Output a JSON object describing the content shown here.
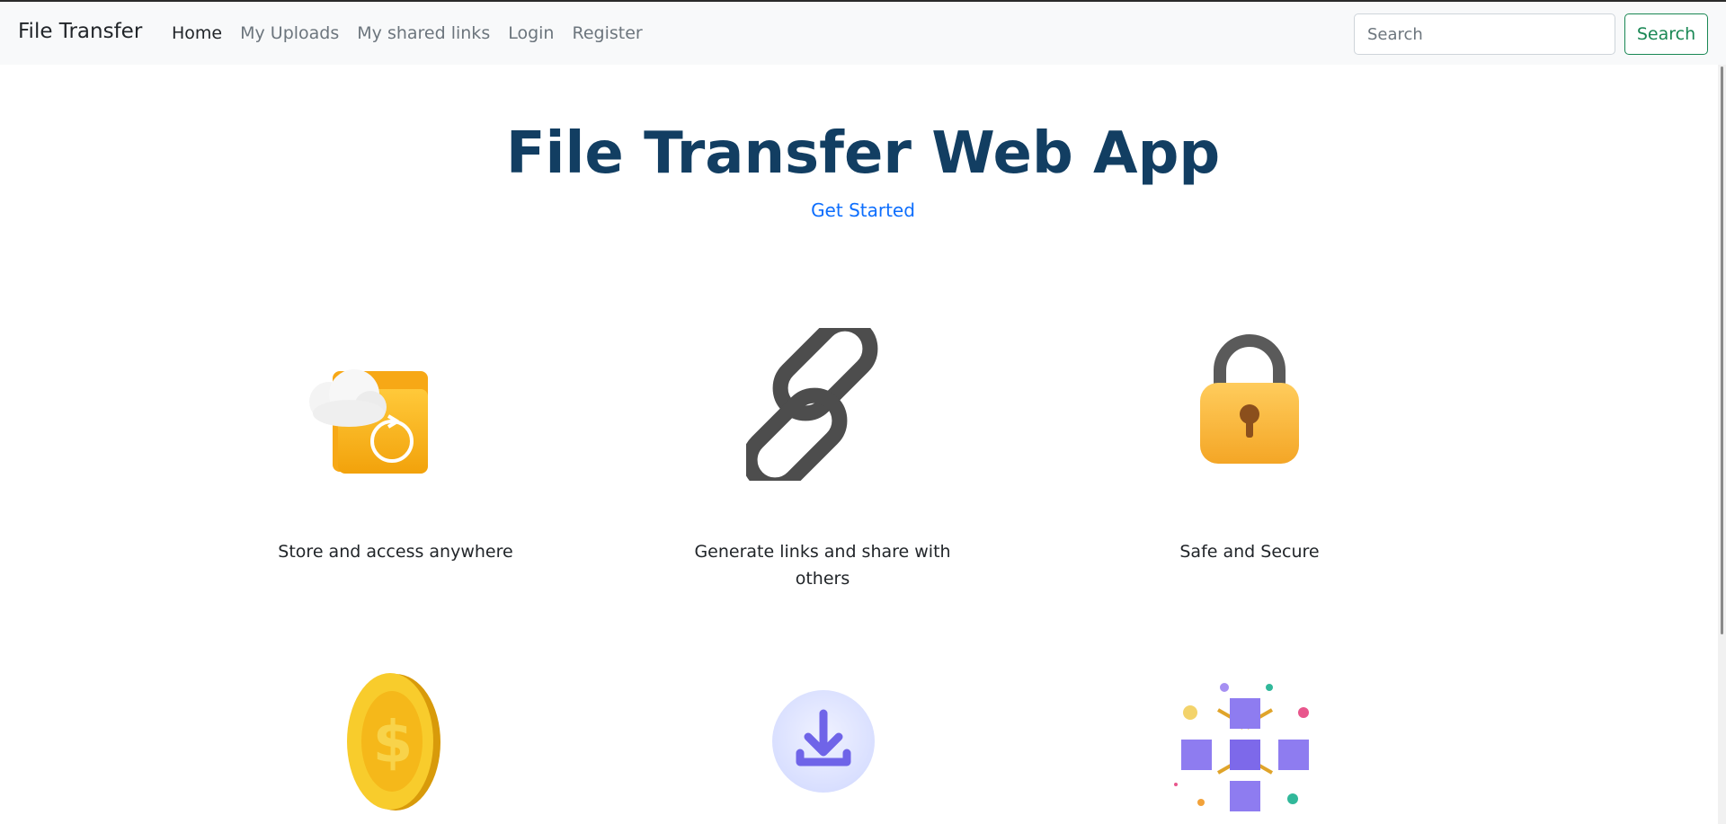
{
  "navbar": {
    "brand": "File Transfer",
    "links": [
      {
        "label": "Home",
        "active": true
      },
      {
        "label": "My Uploads",
        "active": false
      },
      {
        "label": "My shared links",
        "active": false
      },
      {
        "label": "Login",
        "active": false
      },
      {
        "label": "Register",
        "active": false
      }
    ],
    "search": {
      "placeholder": "Search",
      "button_label": "Search"
    }
  },
  "hero": {
    "title": "File Transfer Web App",
    "cta": "Get Started"
  },
  "features": [
    {
      "icon": "cloud-folder-sync-icon",
      "caption": "Store and access anywhere"
    },
    {
      "icon": "chain-link-icon",
      "caption": "Generate links and share with others"
    },
    {
      "icon": "padlock-icon",
      "caption": "Safe and Secure"
    },
    {
      "icon": "dollar-coin-icon",
      "caption": ""
    },
    {
      "icon": "download-icon",
      "caption": ""
    },
    {
      "icon": "blockchain-cubes-icon",
      "caption": ""
    }
  ],
  "colors": {
    "hero_title": "#123e62",
    "link_blue": "#0d6efd",
    "success_green": "#198754",
    "navbar_bg": "#f8f9fa"
  }
}
